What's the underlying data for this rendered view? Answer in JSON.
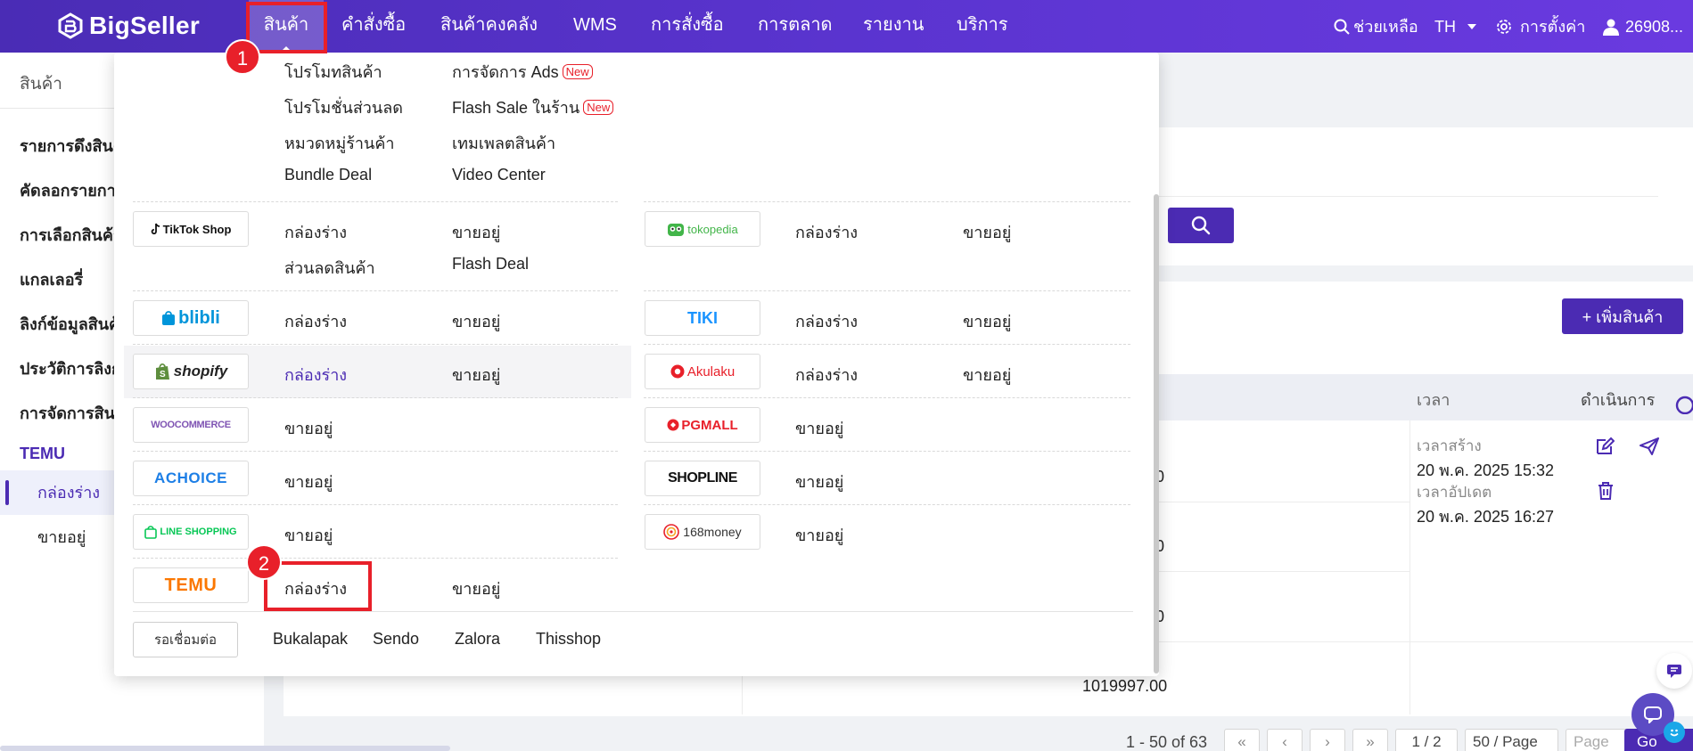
{
  "topbar": {
    "brand": "BigSeller",
    "nav": [
      "สินค้า",
      "คำสั่งซื้อ",
      "สินค้าคงคลัง",
      "WMS",
      "การสั่งซื้อ",
      "การตลาด",
      "รายงาน",
      "บริการ"
    ],
    "help": "ช่วยเหลือ",
    "language": "TH",
    "settings": "การตั้งค่า",
    "user": "26908..."
  },
  "steps": [
    "1",
    "2"
  ],
  "sidebar": {
    "title": "สินค้า",
    "items": [
      "รายการดึงสินค้",
      "คัดลอกรายการ",
      "การเลือกสินค้า",
      "แกลเลอรี่",
      "ลิงก์ข้อมูลสินค้",
      "ประวัติการลิงก์",
      "การจัดการสินค้",
      "TEMU"
    ],
    "sub_items": [
      "กล่องร่าง",
      "ขายอยู่"
    ]
  },
  "dropdown": {
    "general": [
      {
        "label": "โปรโมทสินค้า"
      },
      {
        "label": "การจัดการ Ads",
        "badge": "New"
      },
      {
        "label": "โปรโมชั่นส่วนลด"
      },
      {
        "label": "Flash Sale ในร้าน",
        "badge": "New"
      },
      {
        "label": "หมวดหมู่ร้านค้า"
      },
      {
        "label": "เทมเพลตสินค้า"
      },
      {
        "label": "Bundle Deal"
      },
      {
        "label": "Video Center"
      }
    ],
    "platforms": {
      "tiktok": {
        "logo": "TikTok Shop",
        "links": [
          "กล่องร่าง",
          "ขายอยู่",
          "ส่วนลดสินค้า",
          "Flash Deal"
        ]
      },
      "tokopedia": {
        "logo": "tokopedia",
        "links": [
          "กล่องร่าง",
          "ขายอยู่"
        ]
      },
      "blibli": {
        "logo": "blibli",
        "links": [
          "กล่องร่าง",
          "ขายอยู่"
        ]
      },
      "tiki": {
        "logo": "TIKI",
        "links": [
          "กล่องร่าง",
          "ขายอยู่"
        ]
      },
      "shopify": {
        "logo": "shopify",
        "links": [
          "กล่องร่าง",
          "ขายอยู่"
        ]
      },
      "akulaku": {
        "logo": "Akulaku",
        "links": [
          "กล่องร่าง",
          "ขายอยู่"
        ]
      },
      "woocommerce": {
        "logo": "WOOCOMMERCE",
        "links": [
          "ขายอยู่"
        ]
      },
      "pgmall": {
        "logo": "PGMALL",
        "links": [
          "ขายอยู่"
        ]
      },
      "achoice": {
        "logo": "ACHOICE",
        "links": [
          "ขายอยู่"
        ]
      },
      "shopline": {
        "logo": "SHOPLINE",
        "links": [
          "ขายอยู่"
        ]
      },
      "lineshopping": {
        "logo": "LINE SHOPPING",
        "links": [
          "ขายอยู่"
        ]
      },
      "money168": {
        "logo": "168money",
        "links": [
          "ขายอยู่"
        ]
      },
      "temu": {
        "logo": "TEMU",
        "links": [
          "กล่องร่าง",
          "ขายอยู่"
        ]
      }
    },
    "pending_label": "รอเชื่อมต่อ",
    "pending_platforms": [
      "Bukalapak",
      "Sendo",
      "Zalora",
      "Thisshop"
    ]
  },
  "main": {
    "add_button": "+ เพิ่มสินค้า",
    "columns": {
      "time": "เวลา",
      "actions": "ดำเนินการ"
    },
    "row": {
      "created_label": "เวลาสร้าง",
      "created_value": "20 พ.ค. 2025 15:32",
      "updated_label": "เวลาอัปเดต",
      "updated_value": "20 พ.ค. 2025 16:27"
    },
    "partial_values": [
      "0",
      "0",
      "0"
    ],
    "price": "1019997.00"
  },
  "pagination": {
    "range": "1 - 50 of 63",
    "current": "1 / 2",
    "page_size": "50 / Page",
    "page_placeholder": "Page",
    "go": "Go"
  },
  "colors": {
    "brand": "#4b2bb3",
    "highlight": "#e8202a",
    "temu": "#fb7701"
  }
}
